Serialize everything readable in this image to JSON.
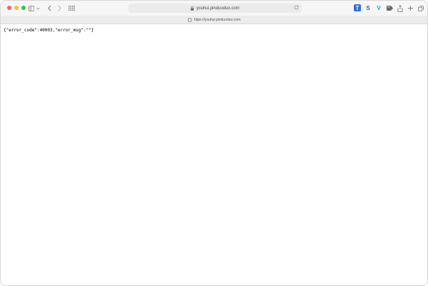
{
  "window": {
    "address_bar": {
      "url": "youhui.pinduoduo.com"
    },
    "tab": {
      "label": "https://youhui.pinduoduo.com"
    }
  },
  "toolbar_icons": {
    "sidebar": "sidebar-icon",
    "back": "chevron-left-icon",
    "forward": "chevron-right-icon",
    "tab_overview": "grid-icon",
    "share": "share-icon",
    "new_tab": "plus-icon",
    "tabs": "tabs-icon"
  },
  "extensions": [
    {
      "name": "translate-extension-icon",
      "glyph": "T",
      "color": "#2f6fd6"
    },
    {
      "name": "s-extension-icon",
      "glyph": "S",
      "color": "#1f5fbf"
    },
    {
      "name": "v-extension-icon",
      "glyph": "V",
      "color": "#1a9ad6"
    },
    {
      "name": "bookmark-extension-icon",
      "glyph": "",
      "color": "#666666"
    }
  ],
  "page": {
    "body_text": "{\"error_code\":40003,\"error_msg\":\"\"}"
  }
}
